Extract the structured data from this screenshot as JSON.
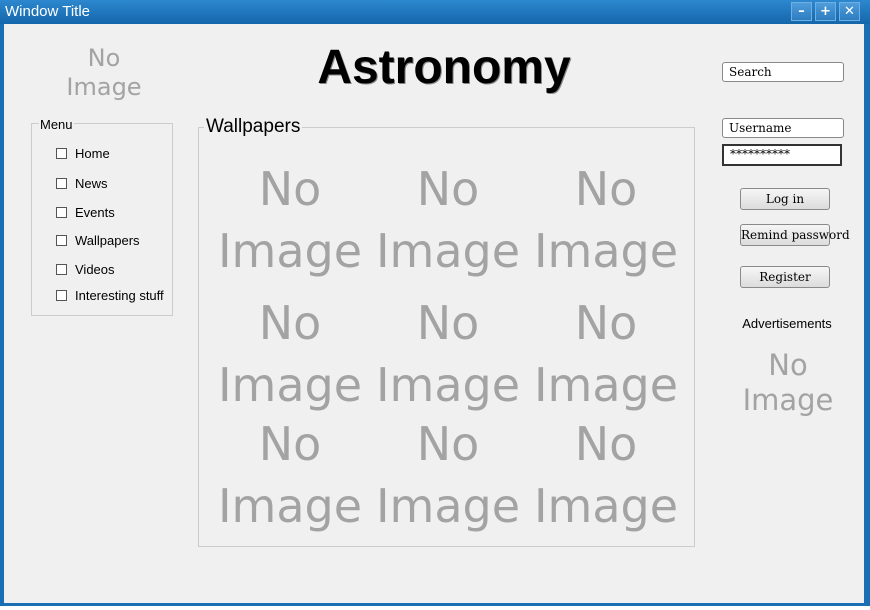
{
  "window": {
    "title": "Window Title",
    "minimize": "–",
    "maximize": "+",
    "close": "✕"
  },
  "logo": {
    "line1": "No",
    "line2": "Image"
  },
  "heading": "Astronomy",
  "menu": {
    "legend": "Menu",
    "items": [
      {
        "label": "Home",
        "checked": false
      },
      {
        "label": "News",
        "checked": false
      },
      {
        "label": "Events",
        "checked": false
      },
      {
        "label": "Wallpapers",
        "checked": false
      },
      {
        "label": "Videos",
        "checked": false
      },
      {
        "label": "Interesting stuff",
        "checked": false
      }
    ]
  },
  "wallpapers": {
    "legend": "Wallpapers",
    "placeholder_line1": "No",
    "placeholder_line2": "Image",
    "count": 9
  },
  "search": {
    "value": "Search"
  },
  "login": {
    "username": "Username",
    "password": "**********",
    "login_button": "Log in",
    "remind_button": "Remind password",
    "register_button": "Register"
  },
  "ads": {
    "label": "Advertisements",
    "line1": "No",
    "line2": "Image"
  },
  "colors": {
    "titlebar": "#1a6fb4",
    "content_bg": "#f0f0f0",
    "placeholder_text": "#a3a3a3"
  }
}
